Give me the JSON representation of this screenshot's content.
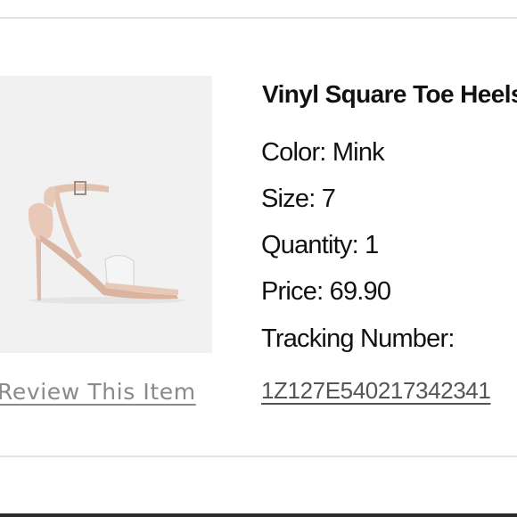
{
  "order_item": {
    "title": "Vinyl Square Toe Heels",
    "color_label": "Color:",
    "color_value": "Mink",
    "size_label": "Size:",
    "size_value": "7",
    "quantity_label": "Quantity:",
    "quantity_value": "1",
    "price_label": "Price:",
    "price_value": "69.90",
    "tracking_label": "Tracking Number:",
    "tracking_number": "1Z127E540217342341",
    "review_link": "Review This Item",
    "image_icon": "sandal-heel-image"
  },
  "colors": {
    "text": "#111111",
    "link_gray": "#8a8a8a",
    "tracking_link": "#555555",
    "image_bg": "#f1f1f1",
    "shoe_nude": "#e8c9b8",
    "divider": "#e3e3e3"
  }
}
